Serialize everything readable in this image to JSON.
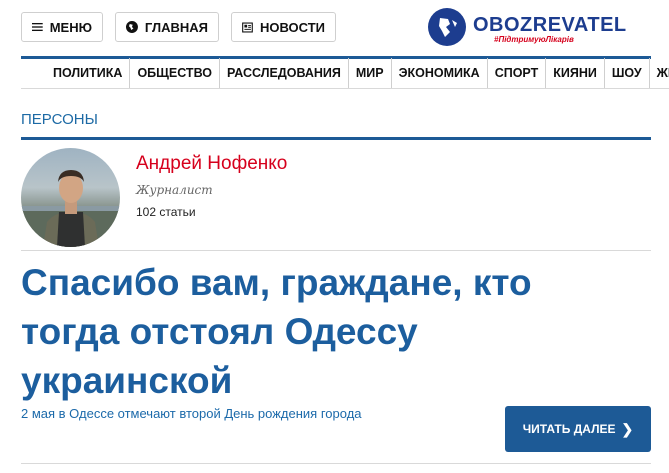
{
  "header": {
    "menu_label": "МЕНЮ",
    "home_label": "ГЛАВНАЯ",
    "news_label": "НОВОСТИ",
    "logo_text": "OBOZREVATEL",
    "logo_tagline": "#ПідтримуюЛікарів",
    "brand_color": "#1d3d8f",
    "accent_color": "#d6001c"
  },
  "nav": {
    "items": [
      "ПОЛИТИКА",
      "ОБЩЕСТВО",
      "РАССЛЕДОВАНИЯ",
      "МИР",
      "ЭКОНОМИКА",
      "СПОРТ",
      "КИЯНИ",
      "ШОУ",
      "ЖЕНСК"
    ]
  },
  "section": {
    "title": "ПЕРСОНЫ"
  },
  "author": {
    "name": "Андрей Нофенко",
    "role": "Журналист",
    "count": "102 статьи"
  },
  "article": {
    "title": "Спасибо вам, граждане, кто тогда отстоял Одессу украинской",
    "lead": "2 мая в Одессе отмечают второй День рождения города",
    "read_more_label": "ЧИТАТЬ ДАЛЕЕ"
  }
}
